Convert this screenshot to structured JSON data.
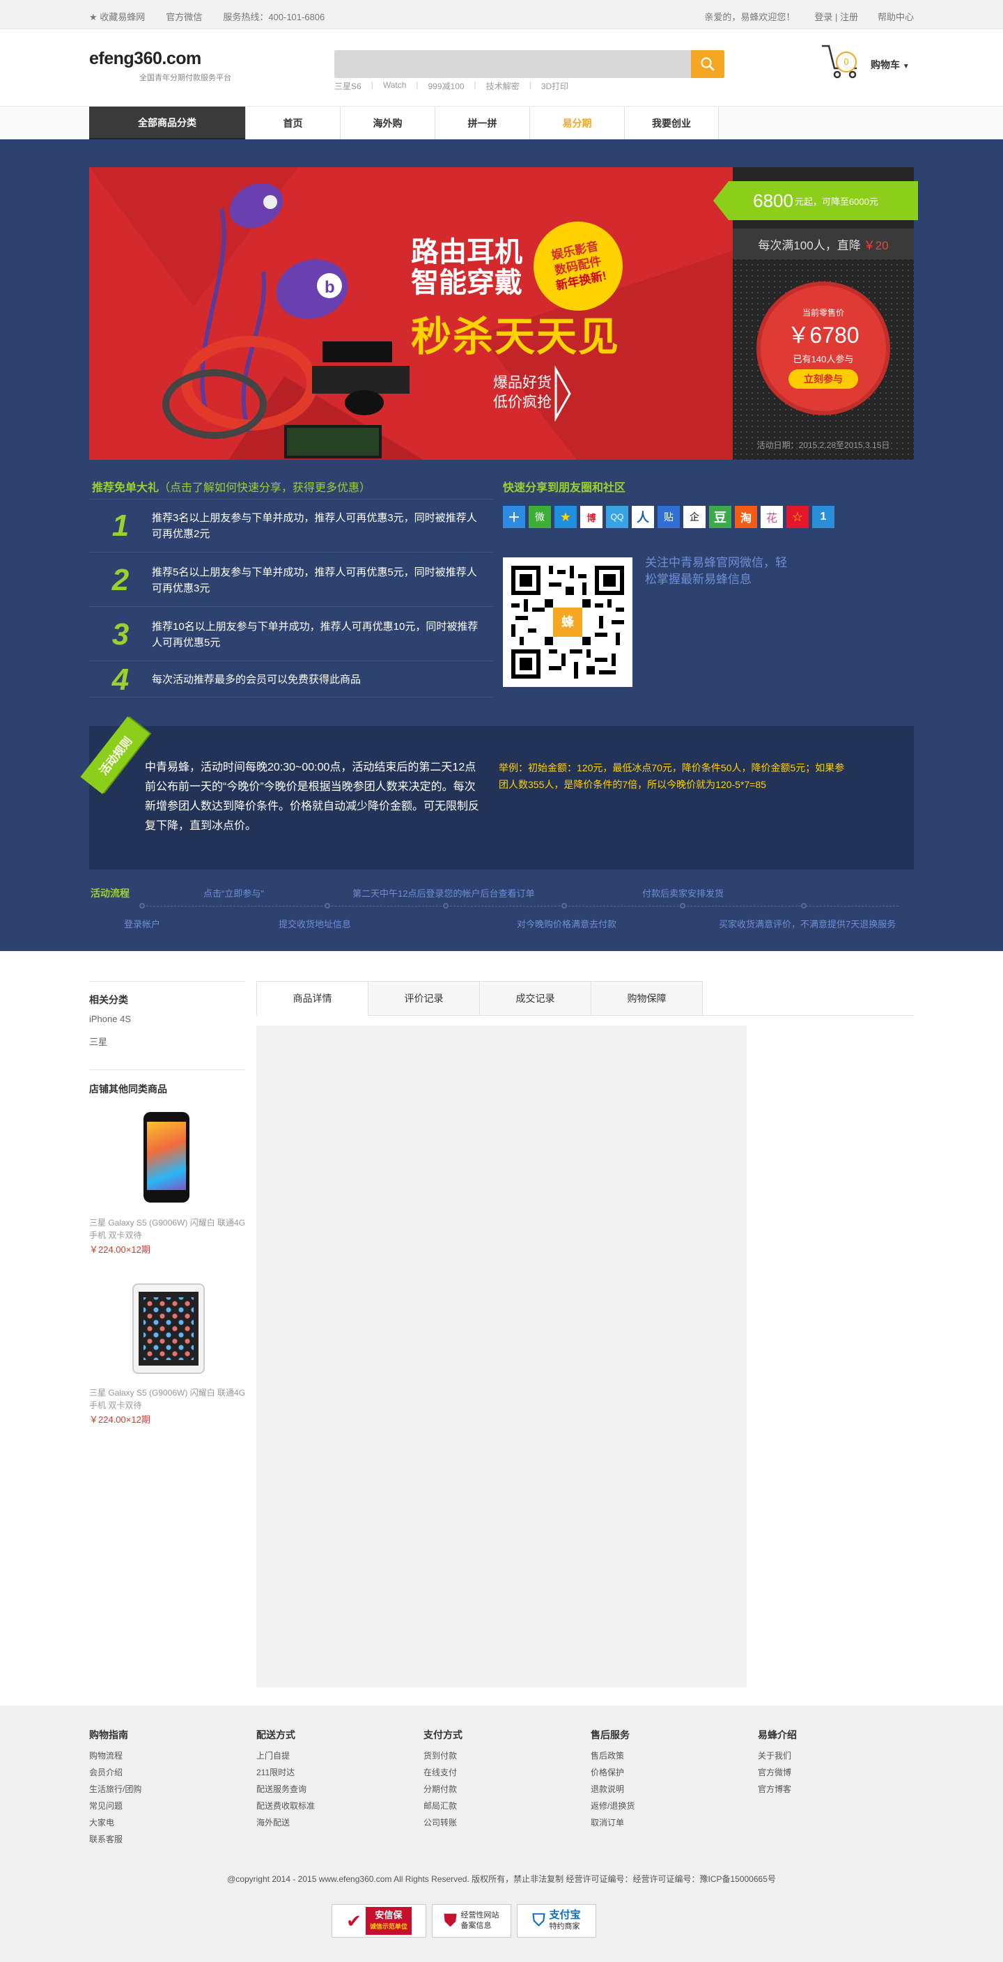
{
  "topbar": {
    "fav": "收藏易蜂网",
    "wechat": "官方微信",
    "hotline": "服务热线：400-101-6806",
    "greeting": "亲爱的，易蜂欢迎您！",
    "login": "登录 | 注册",
    "help": "帮助中心"
  },
  "header": {
    "logo": "efeng360.com",
    "slogan": "全国青年分期付款服务平台",
    "hot": [
      "三星S6",
      "Watch",
      "999减100",
      "技术解密",
      "3D打印"
    ],
    "cart_count": "0",
    "cart_label": "购物车"
  },
  "nav": {
    "category": "全部商品分类",
    "items": [
      "首页",
      "海外购",
      "拼一拼",
      "易分期",
      "我要创业"
    ],
    "active": "易分期"
  },
  "banner": {
    "line1": "路由耳机",
    "line2": "智能穿戴",
    "big": "秒杀天天见",
    "badge1": "娱乐影音",
    "badge2": "数码配件",
    "badge3": "新年换新!",
    "sub1": "爆品好货",
    "sub2": "低价疯抢"
  },
  "promo": {
    "tag_price": "6800",
    "tag_unit": "元起，可降至6000元",
    "rule": "每次满100人，直降",
    "rule_amt": "￥20",
    "cur_label": "当前零售价",
    "cur_price": "￥6780",
    "joined": "已有140人参与",
    "join_btn": "立刻参与",
    "date": "活动日期：2015.2.28至2015.3.15日"
  },
  "share": {
    "title": "推荐免单大礼",
    "title_hint": "（点击了解如何快速分享，获得更多优惠）",
    "rules": [
      {
        "num": "1",
        "text": "推荐3名以上朋友参与下单并成功，推荐人可再优惠3元，同时被推荐人可再优惠2元"
      },
      {
        "num": "2",
        "text": "推荐5名以上朋友参与下单并成功，推荐人可再优惠5元，同时被推荐人可再优惠3元"
      },
      {
        "num": "3",
        "text": "推荐10名以上朋友参与下单并成功，推荐人可再优惠10元，同时被推荐人可再优惠5元"
      },
      {
        "num": "4",
        "text": "每次活动推荐最多的会员可以免费获得此商品"
      }
    ],
    "quick_title": "快速分享到朋友圈和社区",
    "icons": [
      "＋",
      "微",
      "★",
      "博",
      "QQ",
      "人",
      "贴",
      "企",
      "豆",
      "淘",
      "花",
      "☆",
      "1"
    ],
    "qr_center": "蜂",
    "follow": "关注中青易蜂官网微信，轻松掌握最新易蜂信息"
  },
  "rules": {
    "ribbon": "活动规则",
    "text": "中青易蜂，活动时间每晚20:30~00:00点，活动结束后的第二天12点前公布前一天的“今晚价”今晚价是根据当晚参团人数来决定的。每次新增参团人数达到降价条件。价格就自动减少降价金额。可无限制反复下降，直到冰点价。",
    "example": "举例：初始金额：120元，最低冰点70元，降价条件50人，降价金额5元；如果参团人数355人，是降价条件的7倍，所以今晚价就为120-5*7=85"
  },
  "process": {
    "label": "活动流程",
    "top": [
      "点击“立即参与”",
      "第二天中午12点后登录您的帐户后台查看订单",
      "付款后卖家安排发货"
    ],
    "bottom": [
      "登录帐户",
      "提交收货地址信息",
      "对今晚购价格满意去付款",
      "买家收货满意评价，不满意提供7天退换服务"
    ]
  },
  "sidebar": {
    "related": "相关分类",
    "links": [
      "iPhone 4S",
      "三星"
    ],
    "others": "店铺其他同类商品",
    "products": [
      {
        "name": "三星 Galaxy S5 (G9006W) 闪耀白 联通4G手机 双卡双待",
        "price": "￥224.00×12期"
      },
      {
        "name": "三星 Galaxy S5 (G9006W) 闪耀白 联通4G手机 双卡双待",
        "price": "￥224.00×12期"
      }
    ]
  },
  "tabs": [
    "商品详情",
    "评价记录",
    "成交记录",
    "购物保障"
  ],
  "footer": {
    "cols": [
      {
        "title": "购物指南",
        "items": [
          "购物流程",
          "会员介绍",
          "生活旅行/团购",
          "常见问题",
          "大家电",
          "联系客服"
        ]
      },
      {
        "title": "配送方式",
        "items": [
          "上门自提",
          "211限时达",
          "配送服务查询",
          "配送费收取标准",
          "海外配送"
        ]
      },
      {
        "title": "支付方式",
        "items": [
          "货到付款",
          "在线支付",
          "分期付款",
          "邮局汇款",
          "公司转账"
        ]
      },
      {
        "title": "售后服务",
        "items": [
          "售后政策",
          "价格保护",
          "退款说明",
          "返修/退换货",
          "取消订单"
        ]
      },
      {
        "title": "易蜂介绍",
        "items": [
          "关于我们",
          "官方微博",
          "官方博客"
        ]
      }
    ],
    "copyright": "@copyright 2014 - 2015 www.efeng360.com All Rights Reserved. 版权所有，禁止非法复制 经营许可证编号：经营许可证编号：豫ICP备15000665号",
    "badges": [
      "安信保",
      "诚信示范单位",
      "经营性网站",
      "备案信息",
      "支付宝",
      "特约商家"
    ]
  },
  "colors": {
    "accent": "#f5a623",
    "green": "#9bd12e",
    "band": "#2e4270",
    "red": "#d42a2e"
  }
}
